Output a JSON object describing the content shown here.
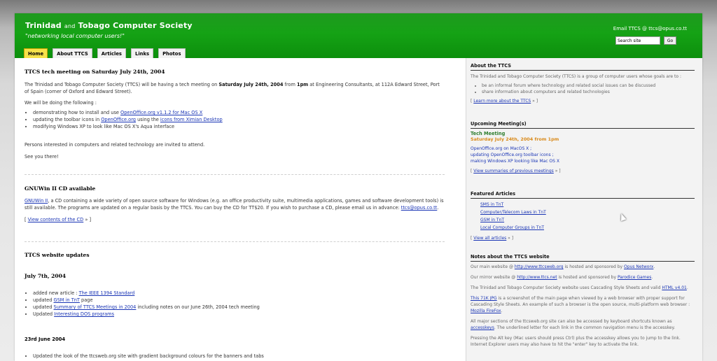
{
  "header": {
    "title_1": "Trinidad",
    "title_and": "and",
    "title_2": "Tobago Computer Society",
    "tagline": "\"networking local computer users!\"",
    "email": "Email TTCS @ ttcs@opus.co.tt",
    "search_value": "Search site",
    "go_label": "Go"
  },
  "tabs": [
    {
      "label": "Home",
      "active": true
    },
    {
      "label": "About TTCS"
    },
    {
      "label": "Articles"
    },
    {
      "label": "Links"
    },
    {
      "label": "Photos"
    }
  ],
  "main": {
    "post1": {
      "title": "TTCS tech meeting on Saturday July 24th, 2004",
      "p1_a": "The Trinidad and Tobago Computer Society (TTCS) will be having a tech meeting on ",
      "p1_b": "Saturday July 24th, 2004",
      "p1_c": " from ",
      "p1_d": "1pm",
      "p1_e": " at Engineering Consultants, at 112A Edward Street, Port of Spain (corner of Oxford and Edward Street).",
      "p2": "We will be doing the following :",
      "li1_a": "demonstrating how to install and use ",
      "li1_link": "OpenOffice.org v1.1.2 for Mac OS X",
      "li2_a": "updating the toolbar icons in ",
      "li2_link1": "OpenOffice.org",
      "li2_b": " using the ",
      "li2_link2": "icons from Ximian Desktop",
      "li3": "modifying Windows XP to look like Mac OS X's Aqua interface",
      "p3": "Persons interested in computers and related technology are invited to attend.",
      "p4": "See you there!"
    },
    "post2": {
      "title": "GNUWin II CD available",
      "link1": "GNUWin II",
      "p1": ", a CD containing a wide variety of open source software for Windows (e.g. an office productivity suite, multimedia applications, games and software development tools) is still available. The programs are updated on a regular basis by the TTCS. You can buy the CD for TT$20. If you wish to purchase a CD, please email us in advance: ",
      "email": "ttcs@opus.co.tt",
      "p1_end": ".",
      "more_pre": "[ ",
      "more_link": "View contents of the CD",
      "more_post": " » ]"
    },
    "post3": {
      "title": "TTCS website updates",
      "date1": "July 7th, 2004",
      "li1_a": "added new article : ",
      "li1_link": "The IEEE 1394 Standard",
      "li2_a": "updated ",
      "li2_link": "GSM in TnT",
      "li2_b": " page",
      "li3_a": "updated ",
      "li3_link": "Summary of TTCS Meetings in 2004",
      "li3_b": " including notes on our June 26th, 2004 tech meeting",
      "li4_a": "Updated ",
      "li4_link": "Interesting DOS programs",
      "date2": "23rd June 2004",
      "li5": "Updated the look of the ttcsweb.org site with gradient background colours for the banners and tabs"
    }
  },
  "side": {
    "about": {
      "title": "About the TTCS",
      "intro": "The Trinidad and Tobago Computer Society (TTCS) is a group of computer users whose goals are to :",
      "li1": "be an informal forum where technology and related social issues can be discussed",
      "li2": "share information about computers and related technologies",
      "more_pre": "[ ",
      "more_link": "Learn more about the TTCS",
      "more_post": " » ]"
    },
    "meetings": {
      "title": "Upcoming Meeting(s)",
      "name": "Tech Meeting",
      "date": "Saturday July 24th, 2004 from 1pm",
      "l1": "OpenOffice.org on MacOS X ;",
      "l2": "updating OpenOffice.org toolbar icons ;",
      "l3": "making Windows XP looking like Mac OS X",
      "more_pre": "[ ",
      "more_link": "View summaries of previous meetings",
      "more_post": " » ]"
    },
    "featured": {
      "title": "Featured Articles",
      "items": [
        "SMS in TnT",
        "Computer/Telecom Laws in TnT",
        "GSM in TnT",
        "Local Computer Groups in TnT"
      ],
      "more_pre": "[ ",
      "more_link": "View all articles",
      "more_post": " » ]"
    },
    "notes": {
      "title": "Notes about the TTCS website",
      "n1_a": "Our main website @ ",
      "n1_link": "http://www.ttcsweb.org",
      "n1_b": " is hosted and sponsored by ",
      "n1_link2": "Opus Networx",
      "n1_c": ".",
      "n2_a": "Our mirror website @ ",
      "n2_link": "http://www.ttcs.net",
      "n2_b": " is hosted and sponsored by ",
      "n2_link2": "Parodice Games",
      "n2_c": ".",
      "n3_a": "The Trinidad and Tobago Computer Society website uses Cascading Style Sheets and valid ",
      "n3_link": "HTML v4.01",
      "n3_b": ".",
      "n4_link": "This 71K JPG",
      "n4_a": " is a screenshot of the main page when viewed by a web browser with proper support for Cascading Style Sheets. An example of such a browser is the open source, multi-platform web browser : ",
      "n4_link2": "Mozilla FireFox",
      "n4_b": ".",
      "n5_a": "All major sections of the ttcsweb.org site can also be accessed by keyboard shortcuts known as ",
      "n5_link": "accesskeys",
      "n5_b": ". The underlined letter for each link in the common navigation menu is the accesskey.",
      "n6": "Pressing the Alt key (Mac users should press Ctrl) plus the accesskey allows you to jump to the link. Internet Explorer users may also have to hit the \"enter\" key to activate the link."
    }
  },
  "colors": {
    "banner_green": "#15a215",
    "active_tab": "#f6e24a",
    "link": "#1a35b5",
    "meeting_green": "#2e7d2e",
    "meeting_orange": "#d98a1a"
  }
}
